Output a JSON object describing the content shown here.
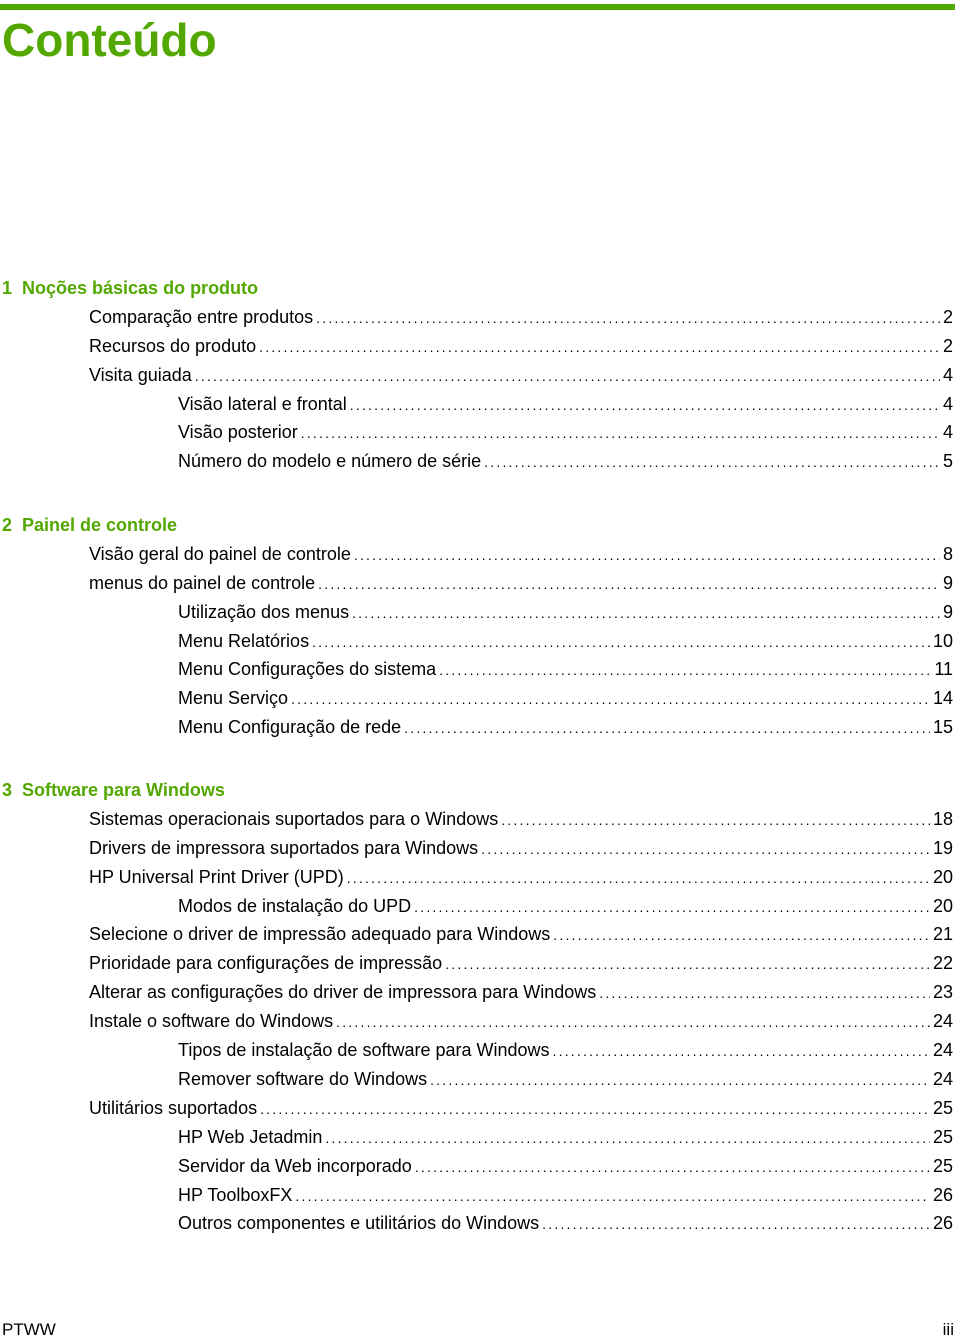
{
  "title": "Conteúdo",
  "accent_color": "#52a800",
  "chapters": [
    {
      "number": "1",
      "title": "Noções básicas do produto",
      "entries": [
        {
          "level": 1,
          "label": "Comparação entre produtos",
          "page": "2"
        },
        {
          "level": 1,
          "label": "Recursos do produto",
          "page": "2"
        },
        {
          "level": 1,
          "label": "Visita guiada",
          "page": "4"
        },
        {
          "level": 2,
          "label": "Visão lateral e frontal",
          "page": "4"
        },
        {
          "level": 2,
          "label": "Visão posterior",
          "page": "4"
        },
        {
          "level": 2,
          "label": "Número do modelo e número de série",
          "page": "5"
        }
      ]
    },
    {
      "number": "2",
      "title": "Painel de controle",
      "entries": [
        {
          "level": 1,
          "label": "Visão geral do painel de controle",
          "page": "8"
        },
        {
          "level": 1,
          "label": "menus do painel de controle",
          "page": "9"
        },
        {
          "level": 2,
          "label": "Utilização dos menus",
          "page": "9"
        },
        {
          "level": 2,
          "label": "Menu Relatórios",
          "page": "10"
        },
        {
          "level": 2,
          "label": "Menu Configurações do sistema",
          "page": "11"
        },
        {
          "level": 2,
          "label": "Menu Serviço",
          "page": "14"
        },
        {
          "level": 2,
          "label": "Menu Configuração de rede",
          "page": "15"
        }
      ]
    },
    {
      "number": "3",
      "title": "Software para Windows",
      "entries": [
        {
          "level": 1,
          "label": "Sistemas operacionais suportados para o Windows",
          "page": "18"
        },
        {
          "level": 1,
          "label": "Drivers de impressora suportados para Windows",
          "page": "19"
        },
        {
          "level": 1,
          "label": "HP Universal Print Driver (UPD)",
          "page": "20"
        },
        {
          "level": 2,
          "label": "Modos de instalação do UPD",
          "page": "20"
        },
        {
          "level": 1,
          "label": "Selecione o driver de impressão adequado para Windows",
          "page": "21"
        },
        {
          "level": 1,
          "label": "Prioridade para configurações de impressão",
          "page": "22"
        },
        {
          "level": 1,
          "label": "Alterar as configurações do driver de impressora para Windows",
          "page": "23"
        },
        {
          "level": 1,
          "label": "Instale o software do Windows",
          "page": "24"
        },
        {
          "level": 2,
          "label": "Tipos de instalação de software para Windows",
          "page": "24"
        },
        {
          "level": 2,
          "label": "Remover software do Windows",
          "page": "24"
        },
        {
          "level": 1,
          "label": "Utilitários suportados",
          "page": "25"
        },
        {
          "level": 2,
          "label": "HP Web Jetadmin",
          "page": "25"
        },
        {
          "level": 2,
          "label": "Servidor da Web incorporado",
          "page": "25"
        },
        {
          "level": 2,
          "label": "HP ToolboxFX",
          "page": "26"
        },
        {
          "level": 2,
          "label": "Outros componentes e utilitários do Windows",
          "page": "26"
        }
      ]
    }
  ],
  "footer": {
    "left": "PTWW",
    "right": "iii"
  }
}
